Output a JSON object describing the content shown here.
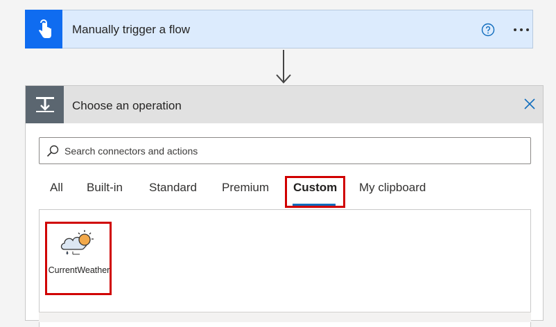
{
  "trigger": {
    "title": "Manually trigger a flow",
    "icon": "touch-hand-icon",
    "accent": "#0f6cf0"
  },
  "operation": {
    "title": "Choose an operation",
    "icon": "step-insert-icon",
    "search": {
      "placeholder": "Search connectors and actions",
      "value": ""
    },
    "tabs": [
      {
        "label": "All"
      },
      {
        "label": "Built-in"
      },
      {
        "label": "Standard"
      },
      {
        "label": "Premium"
      },
      {
        "label": "Custom",
        "active": true
      },
      {
        "label": "My clipboard"
      }
    ],
    "connectors": [
      {
        "label": "CurrentWeather",
        "icon": "cloud-sun-rain-icon"
      }
    ],
    "highlight_color": "#d00000"
  }
}
